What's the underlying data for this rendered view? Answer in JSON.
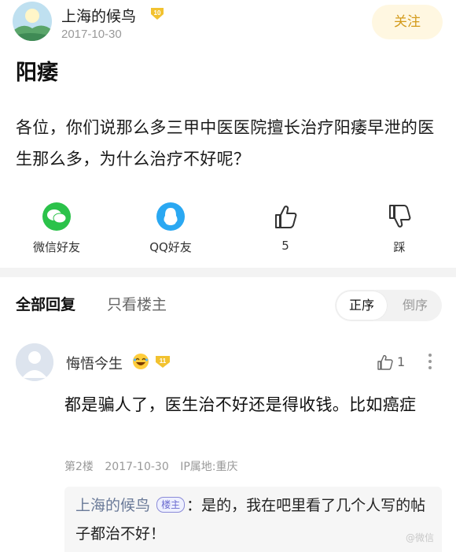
{
  "post": {
    "author_name": "上海的候鸟",
    "author_level": "10",
    "date": "2017-10-30",
    "follow_label": "关注",
    "title": "阳痿",
    "body": "各位，你们说那么多三甲中医医院擅长治疗阳痿早泄的医生那么多，为什么治疗不好呢？"
  },
  "share": {
    "wechat_label": "微信好友",
    "qq_label": "QQ好友",
    "like_count": "5",
    "dislike_label": "踩"
  },
  "tabs": {
    "all_replies": "全部回复",
    "op_only": "只看楼主",
    "sort_asc": "正序",
    "sort_desc": "倒序"
  },
  "reply": {
    "name": "悔悟今生",
    "level": "11",
    "like_count": "1",
    "body": "都是骗人了，医生治不好还是得收钱。比如癌症",
    "floor": "第2楼",
    "date": "2017-10-30",
    "ip": "IP属地:重庆",
    "quote_name": "上海的候鸟",
    "quote_badge": "楼主",
    "quote_text": "：是的，我在吧里看了几个人写的帖子都治不好！"
  },
  "watermark": "@微信",
  "colors": {
    "accent_gold": "#d39a1a",
    "wechat_green": "#2bc24a",
    "qq_blue": "#2aa8f2"
  }
}
